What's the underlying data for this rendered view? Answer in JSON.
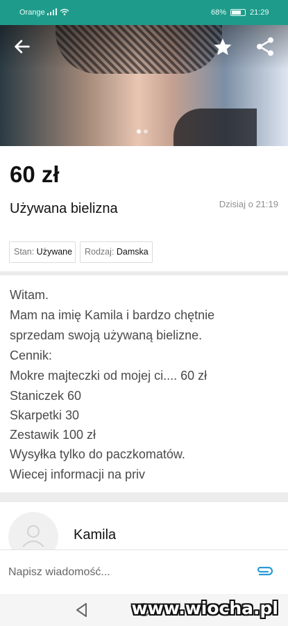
{
  "status_bar": {
    "carrier": "Orange",
    "battery": "68%",
    "time": "21:29"
  },
  "listing": {
    "price": "60 zł",
    "title": "Używana bielizna",
    "posted": "Dzisiaj o 21:19",
    "params": [
      {
        "key": "Stan:",
        "value": "Używane"
      },
      {
        "key": "Rodzaj:",
        "value": "Damska"
      }
    ],
    "gallery": {
      "pages": 2,
      "current": 1
    },
    "description_lines": [
      "Witam.",
      "Mam na imię Kamila i bardzo chętnie",
      "sprzedam swoją używaną bielizne.",
      "Cennik:",
      "Mokre majteczki od mojej ci.... 60 zł",
      "Staniczek 60",
      "Skarpetki 30",
      "Zestawik 100 zł",
      "Wysyłka tylko do paczkomatów.",
      "Wiecej informacji na priv"
    ]
  },
  "seller": {
    "name": "Kamila"
  },
  "composer": {
    "placeholder": "Napisz wiadomość..."
  },
  "watermark": "www.wiocha.pl",
  "icons": {
    "back": "arrow-left-icon",
    "favorite": "star-icon",
    "share": "share-icon",
    "attach": "paperclip-icon",
    "avatar": "user-icon",
    "nav_back": "triangle-back-icon",
    "nav_home": "circle-home-icon"
  },
  "colors": {
    "status_bar": "#1f9b8b",
    "accent": "#2a9ad6",
    "price": "#111111"
  }
}
